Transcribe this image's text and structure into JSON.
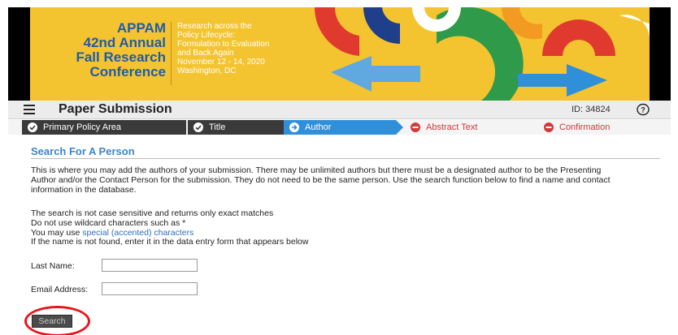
{
  "banner": {
    "title_lines": [
      "APPAM",
      "42nd Annual",
      "Fall Research",
      "Conference"
    ],
    "subtitle_lines": [
      "Research across the",
      "Policy Lifecycle:",
      "Formulation to Evaluation",
      "and Back Again",
      "November 12 - 14, 2020",
      "Washington, DC"
    ],
    "colors": {
      "background": "#f4c430",
      "title": "#1f5ca8",
      "red": "#e03a2f",
      "blue": "#2f8fd8",
      "green": "#2e9a4a",
      "navy": "#1f3f8a"
    }
  },
  "header": {
    "menu_icon": "hamburger-menu-icon",
    "title": "Paper Submission",
    "id_label": "ID: 34824",
    "help_icon": "help-icon"
  },
  "steps": [
    {
      "label": "Primary Policy Area",
      "state": "done",
      "icon": "check-circle-icon"
    },
    {
      "label": "Title",
      "state": "done",
      "icon": "check-circle-icon"
    },
    {
      "label": "Author",
      "state": "current",
      "icon": "arrow-circle-icon"
    },
    {
      "label": "Abstract Text",
      "state": "pending",
      "icon": "minus-circle-icon"
    },
    {
      "label": "Confirmation",
      "state": "pending",
      "icon": "minus-circle-icon"
    }
  ],
  "section": {
    "title": "Search For A Person",
    "intro": "This is where you may add the authors of your submission. There may be unlimited authors but there must be a designated author to be the Presenting Author and/or the Contact Person for the submission. They do not need to be the same person. Use the search function below to find a name and contact information in the database.",
    "rule_1": "The search is not case sensitive and returns only exact matches",
    "rule_2": "Do not use wildcard characters such as *",
    "rule_3_prefix": "You may use ",
    "rule_3_link": "special (accented) characters",
    "rule_4": "If the name is not found, enter it in the data entry form that appears below"
  },
  "form": {
    "last_name_label": "Last Name:",
    "last_name_value": "",
    "email_label": "Email Address:",
    "email_value": "",
    "search_label": "Search"
  }
}
